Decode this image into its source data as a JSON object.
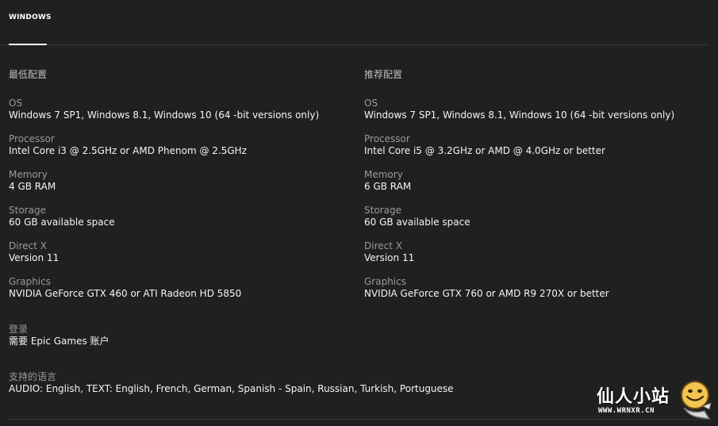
{
  "tabs": [
    {
      "label": "WINDOWS",
      "active": true
    }
  ],
  "minimum": {
    "heading": "最低配置",
    "specs": [
      {
        "label": "OS",
        "value": "Windows 7 SP1, Windows 8.1, Windows 10 (64 -bit versions only)"
      },
      {
        "label": "Processor",
        "value": "Intel Core i3 @ 2.5GHz or AMD Phenom @ 2.5GHz"
      },
      {
        "label": "Memory",
        "value": "4 GB RAM"
      },
      {
        "label": "Storage",
        "value": "60 GB available space"
      },
      {
        "label": "Direct X",
        "value": "Version 11"
      },
      {
        "label": "Graphics",
        "value": "NVIDIA GeForce GTX 460 or ATI Radeon HD 5850"
      }
    ]
  },
  "recommended": {
    "heading": "推荐配置",
    "specs": [
      {
        "label": "OS",
        "value": "Windows 7 SP1, Windows 8.1, Windows 10 (64 -bit versions only)"
      },
      {
        "label": "Processor",
        "value": "Intel Core i5 @ 3.2GHz or AMD @ 4.0GHz or better"
      },
      {
        "label": "Memory",
        "value": "6 GB RAM"
      },
      {
        "label": "Storage",
        "value": "60 GB available space"
      },
      {
        "label": "Direct X",
        "value": "Version 11"
      },
      {
        "label": "Graphics",
        "value": "NVIDIA GeForce GTX 760 or AMD R9 270X or better"
      }
    ]
  },
  "login": {
    "label": "登录",
    "value": "需要 Epic Games 账户"
  },
  "languages": {
    "label": "支持的语言",
    "value": "AUDIO: English, TEXT: English, French, German, Spanish - Spain, Russian, Turkish, Portuguese"
  },
  "watermark": {
    "title": "仙人小站",
    "url": "WWW.WRNXR.CN",
    "logo_icon": "smiley-face-icon"
  },
  "colors": {
    "background": "#202020",
    "label": "#9a9a9a",
    "value": "#f5f5f5",
    "divider": "#3a3a3a"
  }
}
